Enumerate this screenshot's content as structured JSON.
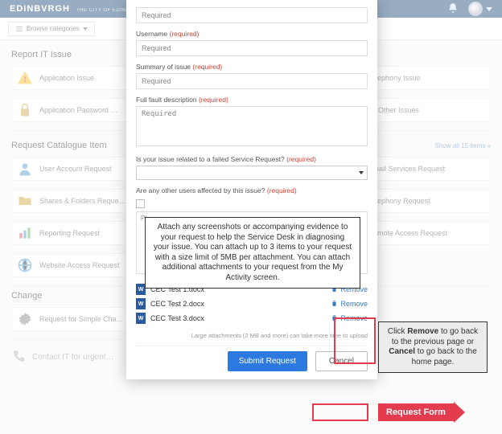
{
  "colors": {
    "brand": "#003366",
    "accent": "#2c7adf",
    "highlight": "#e43c4e",
    "link": "#3a7abf"
  },
  "header": {
    "brand": "EDINBVRGH",
    "subbrand": "THE CITY OF EDINBURGH COUNCIL"
  },
  "subnav": {
    "browse_label": "Browse categories"
  },
  "sections": {
    "report_title": "Report IT Issue",
    "catalogue_title": "Request Catalogue Item",
    "change_title": "Change",
    "showall_label": "Show all 15 items »"
  },
  "cards": {
    "r1c1": "Application Issue",
    "r1c3": "Telephony Issue",
    "r2c1": "Application Password …",
    "r2c3": "All Other Issues",
    "c1c1": "User Account Request",
    "c1c3": "Email Services Request",
    "c2c1": "Shares & Folders Reque…",
    "c2c3": "Telephony Request",
    "c3c1": "Reporting Request",
    "c3c3": "Remote Access Request",
    "c4c1": "Website Access Request",
    "ch1c1": "Request for Simple Cha…",
    "contact_label": "Contact IT for urgent…"
  },
  "modal": {
    "field0_value": "Required",
    "username_label": "Username",
    "username_value": "Required",
    "summary_label": "Summary of issue",
    "summary_value": "Required",
    "full_label": "Full fault description",
    "full_value": "Required",
    "sr_label": "Is your issue related to a failed Service Request?",
    "others_label": "Are any other users affected by this issue?",
    "required_text": "(required)",
    "pl_label": "Pl",
    "attachments": [
      {
        "name": "CEC Test 1.docx",
        "remove": "Remove"
      },
      {
        "name": "CEC Test 2.docx",
        "remove": "Remove"
      },
      {
        "name": "CEC Test 3.docx",
        "remove": "Remove"
      }
    ],
    "note": "Large attachments (2 MB and more) can take more time to upload",
    "submit_label": "Submit Request",
    "cancel_label": "Cancel"
  },
  "callouts": {
    "attach_text": "Attach any screenshots or accompanying evidence to your request to help the Service Desk in diagnosing your issue. You can attach up to 3 items to your request with a size limit of 5MB per attachment. You can attach additional attachments to your request from the My Activity screen.",
    "remove_text_1": "Click ",
    "remove_bold_1": "Remove",
    "remove_text_2": " to go back to the previous page or ",
    "remove_bold_2": "Cancel",
    "remove_text_3": " to go back to the home page.",
    "arrow_label": "Request Form"
  }
}
